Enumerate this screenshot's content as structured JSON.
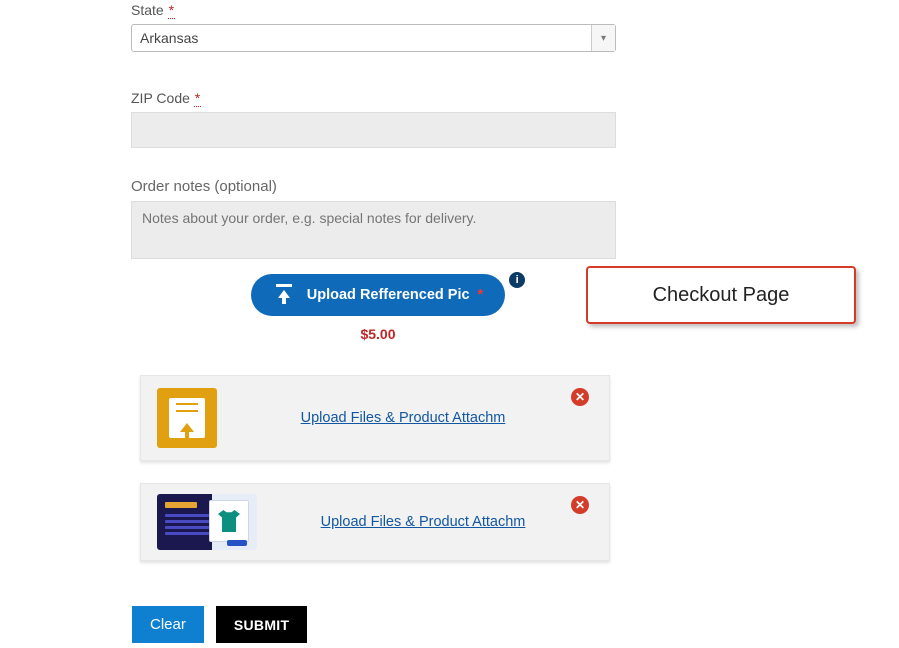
{
  "form": {
    "state_label": "State",
    "state_value": "Arkansas",
    "zip_label": "ZIP Code",
    "zip_value": "",
    "notes_label": "Order notes (optional)",
    "notes_placeholder": "Notes about your order, e.g. special notes for delivery."
  },
  "upload": {
    "button_label": "Upload Refferenced Pic",
    "info_glyph": "i",
    "price": "$5.00"
  },
  "callout": {
    "title": "Checkout Page"
  },
  "files": {
    "item1_label": "Upload Files & Product Attachm",
    "item2_label": "Upload Files & Product Attachm",
    "delete_glyph": "✕"
  },
  "buttons": {
    "clear": "Clear",
    "submit": "SUBMIT"
  },
  "required_asterisk": "*"
}
